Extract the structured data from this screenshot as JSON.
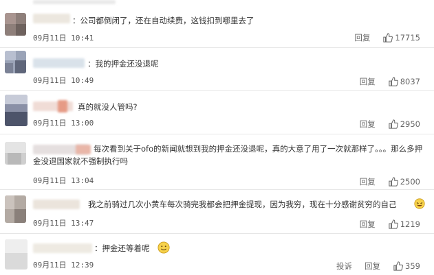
{
  "comments": [
    {
      "text": "：公司都倒闭了，还在自动续费，这钱扣到哪里去了",
      "time": "09月11日 10:41",
      "reply": "回复",
      "likes": "17715"
    },
    {
      "text": "：我的押金还没退呢",
      "time": "09月11日 10:49",
      "reply": "回复",
      "likes": "8037"
    },
    {
      "text": "真的就没人管吗?",
      "time": "09月11日 13:00",
      "reply": "回复",
      "likes": "2950"
    },
    {
      "text": "每次看到关于ofo的新闻就想到我的押金还没退呢，真的大意了用了一次就那样了。。。那么多押金没退国家就不强制执行吗",
      "time": "09月11日 13:04",
      "reply": "回复",
      "likes": "2500"
    },
    {
      "text": "我之前骑过几次小黄车每次骑完我都会把押金提现，因为我穷，现在十分感谢贫穷的自己",
      "time": "09月11日 13:47",
      "reply": "回复",
      "likes": "1219"
    },
    {
      "text": "：押金还等着呢",
      "time": "09月11日 12:39",
      "report": "投诉",
      "reply": "回复",
      "likes": "359"
    }
  ],
  "icons": {
    "like": "thumbs-up-icon",
    "emoji_laugh": "laughing-emoji-icon",
    "emoji_smile": "smiling-emoji-icon"
  }
}
